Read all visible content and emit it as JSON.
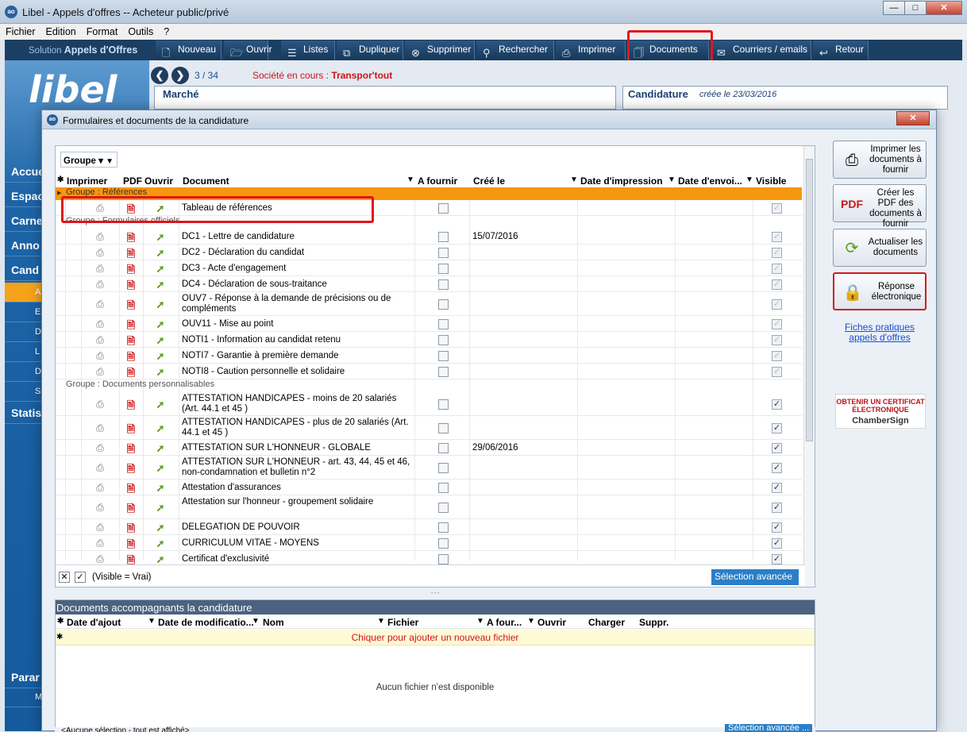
{
  "window": {
    "title": "Libel - Appels d'offres -- Acheteur public/privé",
    "min": "—",
    "max": "□",
    "close": "✕"
  },
  "menu": [
    "Fichier",
    "Edition",
    "Format",
    "Outils",
    "?"
  ],
  "brand": {
    "prefix": "Solution",
    "name": "Appels d'Offres"
  },
  "toolbar": [
    {
      "label": "Nouveau",
      "icon": "new-document-icon",
      "glyph": "🗋"
    },
    {
      "label": "Ouvrir",
      "icon": "folder-icon",
      "glyph": "🗁"
    },
    {
      "label": "Listes",
      "icon": "list-icon",
      "glyph": "☰"
    },
    {
      "label": "Dupliquer",
      "icon": "duplicate-icon",
      "glyph": "⧉"
    },
    {
      "label": "Supprimer",
      "icon": "delete-icon",
      "glyph": "⊗"
    },
    {
      "label": "Rechercher",
      "icon": "search-icon",
      "glyph": "⚲"
    },
    {
      "label": "Imprimer",
      "icon": "printer-icon",
      "glyph": "⎙"
    },
    {
      "label": "Documents",
      "icon": "documents-icon",
      "glyph": "🗍"
    },
    {
      "label": "Courriers / emails",
      "icon": "mail-icon",
      "glyph": "✉"
    },
    {
      "label": "Retour",
      "icon": "return-icon",
      "glyph": "↩"
    }
  ],
  "logo": "libel",
  "leftnav": {
    "main": [
      "Accue",
      "Espac",
      "Carne",
      "Anno",
      "Cand",
      "Statis",
      "Parar"
    ],
    "sub": [
      "A",
      "E",
      "D",
      "L",
      "D",
      "S",
      "M"
    ]
  },
  "record": {
    "pos": "3 / 34",
    "societe_label": "Société en cours :",
    "societe": "Transpor'tout",
    "prev": "❮",
    "next": "❯"
  },
  "marche": {
    "label": "Marché"
  },
  "candidature": {
    "label": "Candidature",
    "created": "créée le 23/03/2016"
  },
  "dialog": {
    "title": "Formulaires et documents de la candidature",
    "close": "✕",
    "group_chooser": "Groupe",
    "filter_glyph": "▼",
    "columns": [
      "Imprimer",
      "PDF",
      "Ouvrir",
      "Document",
      "A fournir",
      "Créé le",
      "Date d'impression",
      "Date d'envoi...",
      "Visible"
    ],
    "groups": [
      {
        "name": "Groupe : Références",
        "rows": [
          {
            "doc": "Tableau de références",
            "date": "",
            "visible": false
          }
        ]
      },
      {
        "name": "Groupe : Formulaires officiels",
        "rows": [
          {
            "doc": "DC1 - Lettre de candidature",
            "date": "15/07/2016",
            "visible": false
          },
          {
            "doc": "DC2 - Déclaration du candidat",
            "date": "",
            "visible": false
          },
          {
            "doc": "DC3 - Acte d'engagement",
            "date": "",
            "visible": false
          },
          {
            "doc": "DC4 - Déclaration de sous-traitance",
            "date": "",
            "visible": false
          },
          {
            "doc": "OUV7 - Réponse à la demande de précisions ou de compléments",
            "date": "",
            "visible": false
          },
          {
            "doc": "OUV11 - Mise au point",
            "date": "",
            "visible": false
          },
          {
            "doc": "NOTI1 - Information au candidat retenu",
            "date": "",
            "visible": false
          },
          {
            "doc": "NOTI7 - Garantie à première demande",
            "date": "",
            "visible": false
          },
          {
            "doc": "NOTI8 - Caution personnelle et solidaire",
            "date": "",
            "visible": false
          }
        ]
      },
      {
        "name": "Groupe : Documents personnalisables",
        "rows": [
          {
            "doc": "ATTESTATION HANDICAPES - moins de 20 salariés (Art. 44.1 et 45 )",
            "date": "",
            "visible": true
          },
          {
            "doc": "ATTESTATION HANDICAPES - plus de 20 salariés (Art. 44.1 et 45 )",
            "date": "",
            "visible": true
          },
          {
            "doc": "ATTESTATION SUR L'HONNEUR - GLOBALE",
            "date": "29/06/2016",
            "visible": true
          },
          {
            "doc": "ATTESTATION SUR L'HONNEUR - art. 43, 44, 45 et 46, non-condamnation et bulletin n°2",
            "date": "",
            "visible": true
          },
          {
            "doc": "Attestation d'assurances",
            "date": "",
            "visible": true
          },
          {
            "doc": "Attestation sur l'honneur - groupement solidaire",
            "date": "",
            "visible": true
          },
          {
            "doc": "DELEGATION DE POUVOIR",
            "date": "",
            "visible": true
          },
          {
            "doc": "CURRICULUM VITAE - MOYENS",
            "date": "",
            "visible": true
          },
          {
            "doc": "Certificat d'exclusivité",
            "date": "",
            "visible": true
          }
        ]
      }
    ],
    "footer_filter": "(Visible = Vrai)",
    "selection_avancee": "Sélection avancée ...",
    "buttons": {
      "print": "Imprimer les documents à fournir",
      "pdf": "Créer les PDF des documents à fournir",
      "refresh": "Actualiser les documents",
      "reponse": "Réponse électronique"
    },
    "link": "Fiches pratiques appels d'offres",
    "cert": {
      "line1": "OBTENIR UN CERTIFICAT ÉLECTRONIQUE",
      "brand": "ChamberSign"
    },
    "docs": {
      "title": "Documents accompagnants la candidature",
      "columns": [
        "Date d'ajout",
        "Date de modificatio...",
        "Nom",
        "Fichier",
        "A four...",
        "Ouvrir",
        "Charger",
        "Suppr."
      ],
      "add": "Chiquer pour ajouter un nouveau fichier",
      "empty": "Aucun fichier n'est disponible",
      "bottom": "<Aucune sélection - tout est affiché>",
      "selection_avancee": "Sélection avancée ..."
    }
  }
}
